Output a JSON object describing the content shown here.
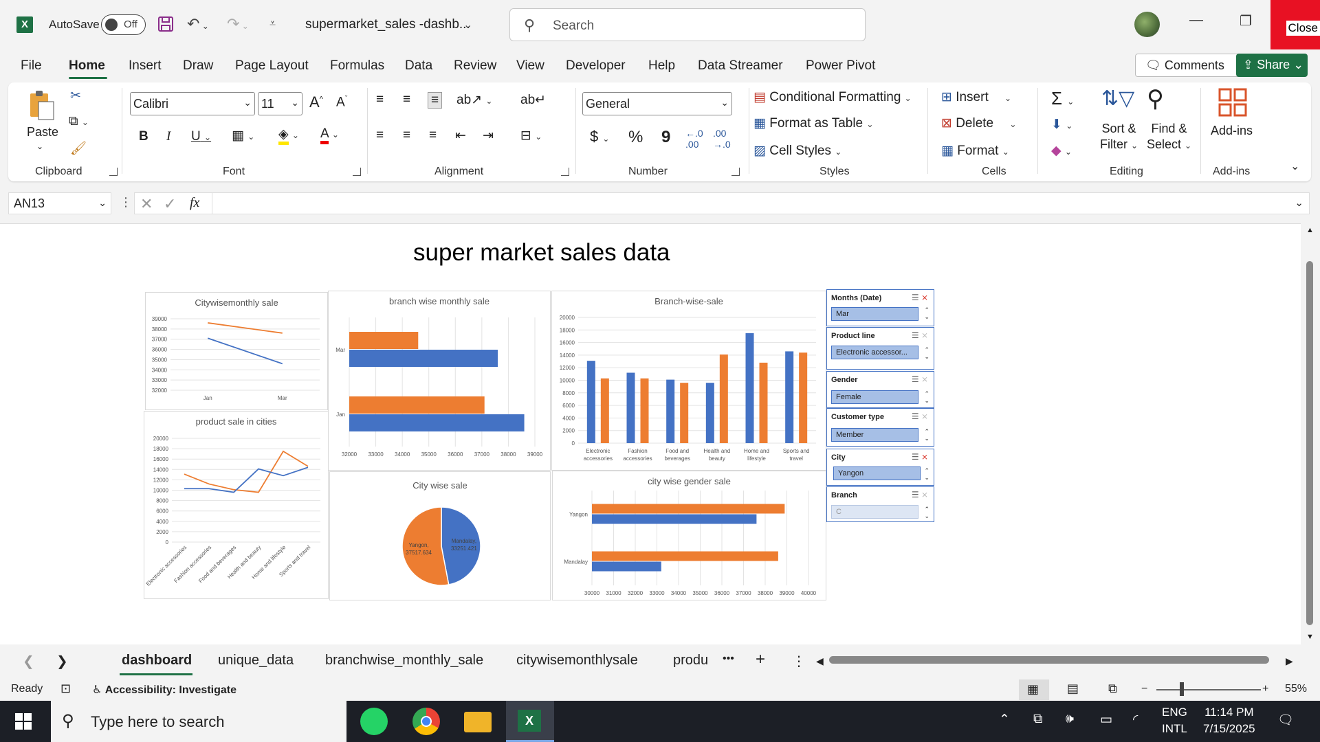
{
  "titlebar": {
    "autosave_label": "AutoSave",
    "autosave_state": "Off",
    "doc_title": "supermarket_sales -dashb...",
    "search_placeholder": "Search",
    "close_label": "Close"
  },
  "menu": {
    "items": [
      "File",
      "Home",
      "Insert",
      "Draw",
      "Page Layout",
      "Formulas",
      "Data",
      "Review",
      "View",
      "Developer",
      "Help",
      "Data Streamer",
      "Power Pivot"
    ],
    "active": "Home",
    "comments": "Comments",
    "share": "Share"
  },
  "ribbon": {
    "clipboard": {
      "paste": "Paste",
      "label": "Clipboard"
    },
    "font": {
      "name": "Calibri",
      "size": "11",
      "label": "Font",
      "bold": "B",
      "italic": "I",
      "underline": "U",
      "grow": "A",
      "shrink": "A"
    },
    "alignment": {
      "label": "Alignment"
    },
    "number": {
      "format": "General",
      "label": "Number",
      "currency": "$",
      "percent": "%",
      "comma": "9"
    },
    "styles": {
      "conditional": "Conditional Formatting",
      "table": "Format as Table",
      "cell": "Cell Styles",
      "label": "Styles"
    },
    "cells": {
      "insert": "Insert",
      "delete": "Delete",
      "format": "Format",
      "label": "Cells"
    },
    "editing": {
      "sort_line1": "Sort &",
      "sort_line2": "Filter",
      "find_line1": "Find &",
      "find_line2": "Select",
      "label": "Editing"
    },
    "addins": {
      "button": "Add-ins",
      "label": "Add-ins"
    }
  },
  "formula_bar": {
    "name_box": "AN13",
    "fx": "fx",
    "formula": ""
  },
  "sheet": {
    "title": "super market sales data"
  },
  "chart_data": [
    {
      "type": "line",
      "title": "Citywisemonthly sale",
      "categories": [
        "Jan",
        "Mar"
      ],
      "series": [
        {
          "values": [
            38600,
            37600
          ],
          "color": "#ed7d31"
        },
        {
          "values": [
            37100,
            34600
          ],
          "color": "#4472c4"
        }
      ],
      "ylim": [
        32000,
        39000
      ],
      "yticks": [
        32000,
        33000,
        34000,
        35000,
        36000,
        37000,
        38000,
        39000
      ]
    },
    {
      "type": "bar",
      "orientation": "horizontal",
      "title": "branch wise monthly sale",
      "categories": [
        "Mar",
        "Jan"
      ],
      "series": [
        {
          "values": [
            34600,
            37100
          ],
          "color": "#ed7d31"
        },
        {
          "values": [
            37600,
            38600
          ],
          "color": "#4472c4"
        }
      ],
      "xlim": [
        32000,
        39000
      ],
      "xticks": [
        32000,
        33000,
        34000,
        35000,
        36000,
        37000,
        38000,
        39000
      ]
    },
    {
      "type": "bar",
      "title": "Branch-wise-sale",
      "categories": [
        "Electronic accessories",
        "Fashion accessories",
        "Food and beverages",
        "Health and beauty",
        "Home and lifestyle",
        "Sports and travel"
      ],
      "category_lines": [
        [
          "Electronic",
          "accessories"
        ],
        [
          "Fashion",
          "accessories"
        ],
        [
          "Food and",
          "beverages"
        ],
        [
          "Health and",
          "beauty"
        ],
        [
          "Home and",
          "lifestyle"
        ],
        [
          "Sports and",
          "travel"
        ]
      ],
      "series": [
        {
          "values": [
            13100,
            11200,
            10100,
            9600,
            17500,
            14600
          ],
          "color": "#4472c4"
        },
        {
          "values": [
            10300,
            10300,
            9600,
            14100,
            12800,
            14400
          ],
          "color": "#ed7d31"
        }
      ],
      "ylim": [
        0,
        20000
      ],
      "yticks": [
        0,
        2000,
        4000,
        6000,
        8000,
        10000,
        12000,
        14000,
        16000,
        18000,
        20000
      ]
    },
    {
      "type": "line",
      "title": "product sale in cities",
      "categories": [
        "Electronic accessories",
        "Fashion accessories",
        "Food and beverages",
        "Health and beauty",
        "Home and lifestyle",
        "Sports and travel"
      ],
      "series": [
        {
          "values": [
            13100,
            11200,
            10100,
            9600,
            17500,
            14600
          ],
          "color": "#ed7d31"
        },
        {
          "values": [
            10300,
            10300,
            9600,
            14100,
            12800,
            14400
          ],
          "color": "#4472c4"
        }
      ],
      "ylim": [
        0,
        20000
      ],
      "yticks": [
        0,
        2000,
        4000,
        6000,
        8000,
        10000,
        12000,
        14000,
        16000,
        18000,
        20000
      ]
    },
    {
      "type": "pie",
      "title": "City wise sale",
      "slices": [
        {
          "label": "Mandalay,",
          "value_label": "33251.421",
          "value": 33251.421,
          "color": "#4472c4"
        },
        {
          "label": "Yangon,",
          "value_label": "37517.634",
          "value": 37517.634,
          "color": "#ed7d31"
        }
      ]
    },
    {
      "type": "bar",
      "orientation": "horizontal",
      "title": "city wise gender sale",
      "categories": [
        "Yangon",
        "Mandalay"
      ],
      "series": [
        {
          "values": [
            38900,
            38600
          ],
          "color": "#ed7d31"
        },
        {
          "values": [
            37600,
            33200
          ],
          "color": "#4472c4"
        }
      ],
      "xlim": [
        30000,
        40000
      ],
      "xticks": [
        30000,
        31000,
        32000,
        33000,
        34000,
        35000,
        36000,
        37000,
        38000,
        39000,
        40000
      ]
    }
  ],
  "slicers": [
    {
      "header": "Months (Date)",
      "value": "Mar",
      "active_filter": true
    },
    {
      "header": "Product line",
      "value": "Electronic accessor...",
      "active_filter": false
    },
    {
      "header": "Gender",
      "value": "Female",
      "active_filter": false
    },
    {
      "header": "Customer type",
      "value": "Member",
      "active_filter": false
    },
    {
      "header": "City",
      "value": "Yangon",
      "active_filter": true
    },
    {
      "header": "Branch",
      "value": "C",
      "active_filter": false,
      "dim": true
    }
  ],
  "tabs": {
    "items": [
      "dashboard",
      "unique_data",
      "branchwise_monthly_sale",
      "citywisemonthlysale",
      "produ"
    ],
    "active": "dashboard",
    "more": "•••",
    "add": "+"
  },
  "status": {
    "ready": "Ready",
    "accessibility": "Accessibility: Investigate",
    "zoom": "55%"
  },
  "taskbar": {
    "search": "Type here to search",
    "lang1": "ENG",
    "lang2": "INTL",
    "time": "11:14 PM",
    "date": "7/15/2025"
  }
}
